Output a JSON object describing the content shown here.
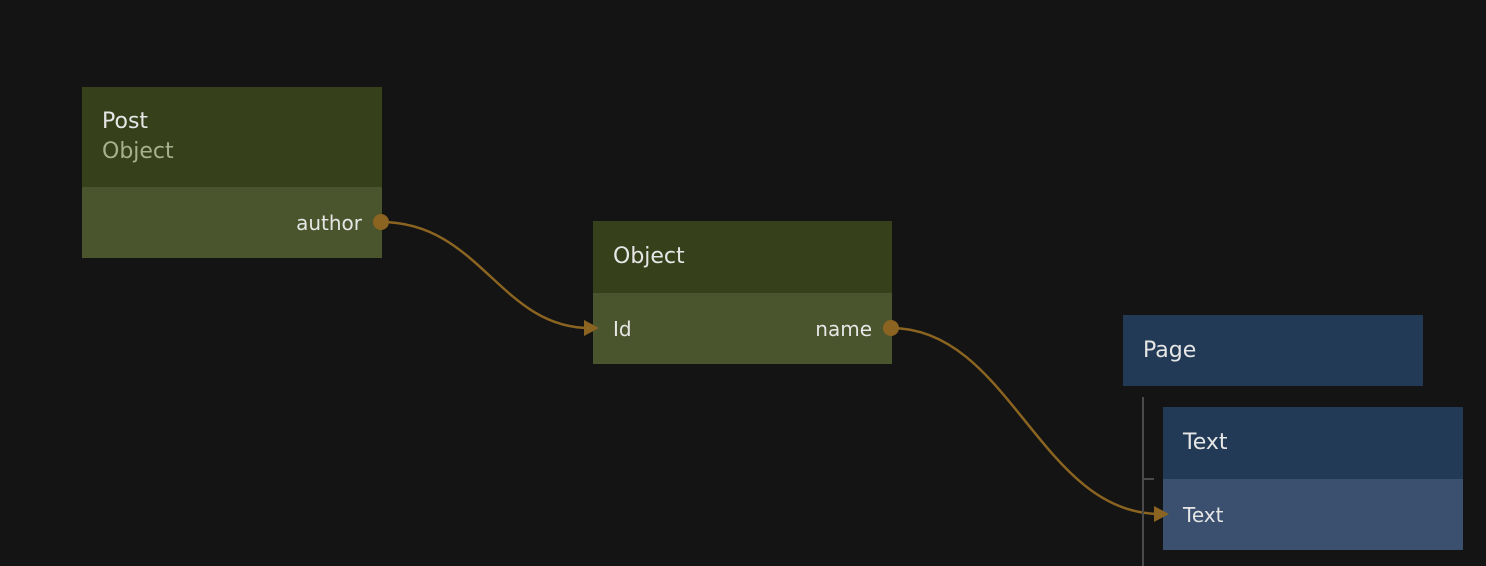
{
  "colors": {
    "background": "#141414",
    "object_header": "#36411b",
    "object_body": "#4b552d",
    "object_subtitle": "#a7b08e",
    "ui_header": "#223a55",
    "ui_body": "#3a506e",
    "wire": "#8a6420",
    "port": "#8a6420"
  },
  "nodes": {
    "post": {
      "title": "Post",
      "subtitle": "Object",
      "output_port": "author"
    },
    "object": {
      "title": "Object",
      "input_port": "Id",
      "output_port": "name"
    },
    "page": {
      "title": "Page"
    },
    "text": {
      "title": "Text",
      "input_port": "Text"
    }
  },
  "connections": [
    {
      "from": "post.author",
      "to": "object.Id"
    },
    {
      "from": "object.name",
      "to": "text.Text"
    }
  ]
}
